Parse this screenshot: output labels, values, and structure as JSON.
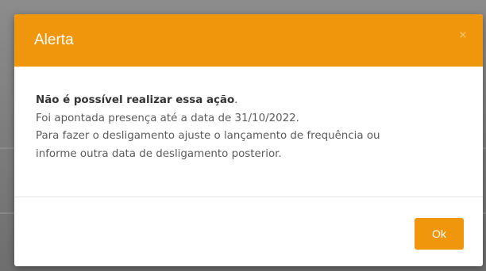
{
  "dialog": {
    "title": "Alerta",
    "close_label": "×",
    "message": {
      "heading": "Não é possível realizar essa ação",
      "heading_suffix": ".",
      "lines": [
        "Foi apontada presença até a data de 31/10/2022.",
        "Para fazer o desligamento ajuste o lançamento de frequência ou",
        "informe outra data de desligamento posterior."
      ]
    },
    "ok_label": "Ok"
  },
  "colors": {
    "accent": "#f0960d",
    "backdrop": "#7a7a7a",
    "text": "#5b5b5b"
  }
}
